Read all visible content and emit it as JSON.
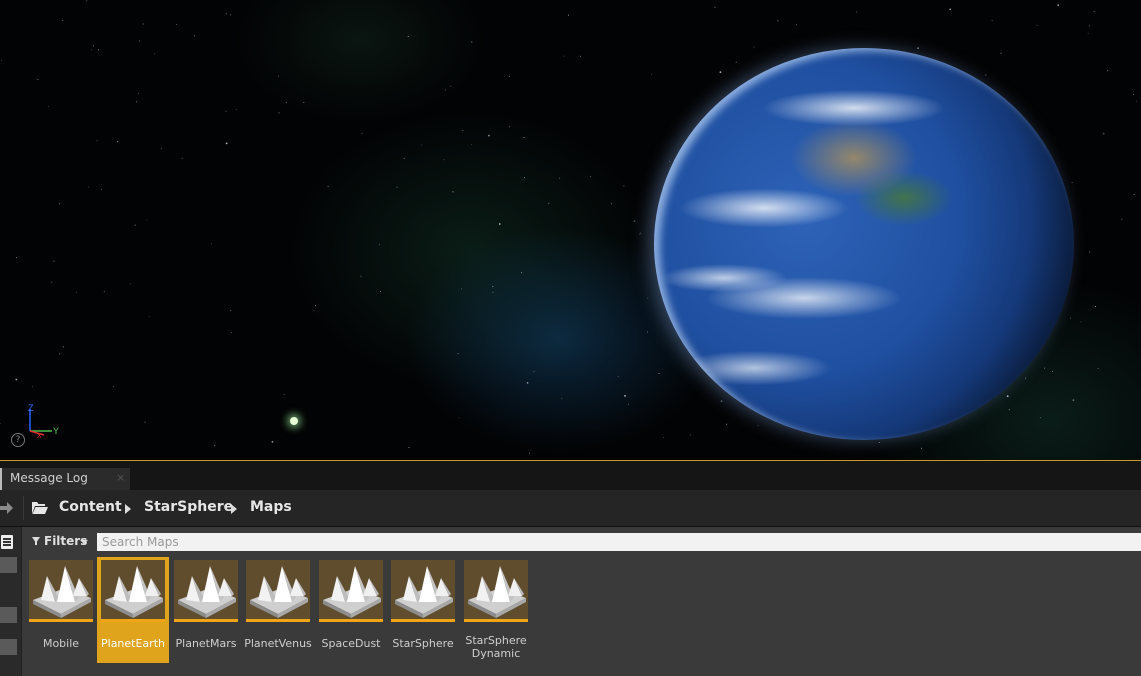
{
  "message_log_tab": {
    "label": "Message Log",
    "close_glyph": "×"
  },
  "path_bar": {
    "crumbs": [
      "Content",
      "StarSphere",
      "Maps"
    ]
  },
  "axis_gizmo": {
    "z_label": "Z",
    "y_label": "Y",
    "x_label": "X"
  },
  "help_glyph": "?",
  "filters": {
    "label": "Filters"
  },
  "search": {
    "placeholder": "Search Maps",
    "value": ""
  },
  "assets": {
    "items": [
      {
        "label": "Mobile",
        "selected": false
      },
      {
        "label": "PlanetEarth",
        "selected": true
      },
      {
        "label": "PlanetMars",
        "selected": false
      },
      {
        "label": "PlanetVenus",
        "selected": false
      },
      {
        "label": "SpaceDust",
        "selected": false
      },
      {
        "label": "StarSphere",
        "selected": false
      },
      {
        "label": "StarSphere Dynamic",
        "selected": false
      }
    ]
  },
  "colors": {
    "accent_orange": "#e0a31c",
    "viewport_border": "#c79a2a",
    "panel_bg": "#3a3a3a"
  }
}
